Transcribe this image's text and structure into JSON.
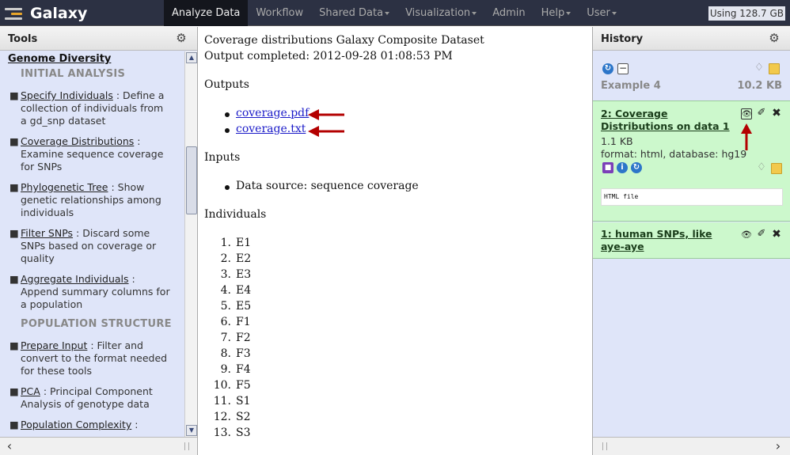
{
  "masthead": {
    "brand": "Galaxy",
    "nav": [
      {
        "label": "Analyze Data",
        "active": true,
        "dropdown": false
      },
      {
        "label": "Workflow",
        "active": false,
        "dropdown": false
      },
      {
        "label": "Shared Data",
        "active": false,
        "dropdown": true
      },
      {
        "label": "Visualization",
        "active": false,
        "dropdown": true
      },
      {
        "label": "Admin",
        "active": false,
        "dropdown": false
      },
      {
        "label": "Help",
        "active": false,
        "dropdown": true
      },
      {
        "label": "User",
        "active": false,
        "dropdown": true
      }
    ],
    "usage": "Using 128.7 GB"
  },
  "tools_panel": {
    "title": "Tools",
    "section": "Genome Diversity",
    "subheads": [
      "INITIAL ANALYSIS",
      "POPULATION STRUCTURE"
    ],
    "tools": [
      {
        "name": "Specify Individuals",
        "desc": ": Define a collection of individuals from a gd_snp dataset"
      },
      {
        "name": "Coverage Distributions",
        "desc": ": Examine sequence coverage for SNPs"
      },
      {
        "name": "Phylogenetic Tree",
        "desc": ": Show genetic relationships among individuals"
      },
      {
        "name": "Filter SNPs",
        "desc": ": Discard some SNPs based on coverage or quality"
      },
      {
        "name": "Aggregate Individuals",
        "desc": ": Append summary columns for a population"
      },
      {
        "name": "Prepare Input",
        "desc": ": Filter and convert to the format needed for these tools"
      },
      {
        "name": "PCA",
        "desc": ": Principal Component Analysis of genotype data"
      },
      {
        "name": "Population Complexity",
        "desc": ":"
      }
    ]
  },
  "center": {
    "title": "Coverage distributions Galaxy Composite Dataset",
    "completed": "Output completed: 2012-09-28 01:08:53 PM",
    "outputs_heading": "Outputs",
    "outputs": [
      "coverage.pdf",
      "coverage.txt"
    ],
    "inputs_heading": "Inputs",
    "inputs": [
      "Data source: sequence coverage"
    ],
    "individuals_heading": "Individuals",
    "individuals": [
      "E1",
      "E2",
      "E3",
      "E4",
      "E5",
      "F1",
      "F2",
      "F3",
      "F4",
      "F5",
      "S1",
      "S2",
      "S3"
    ]
  },
  "history": {
    "title": "History",
    "name": "Example 4",
    "size": "10.2 KB",
    "datasets": [
      {
        "title": "2: Coverage Distributions on data 1",
        "size": "1.1 KB",
        "meta": "format: html, database: hg19",
        "peek": "HTML file"
      },
      {
        "title": "1: human SNPs, like aye-aye"
      }
    ]
  },
  "colors": {
    "masthead": "#2c3143",
    "panel_bg": "#dfe5f9",
    "dataset_ok": "#ccf8cc",
    "annotation_arrow": "#b30000"
  }
}
